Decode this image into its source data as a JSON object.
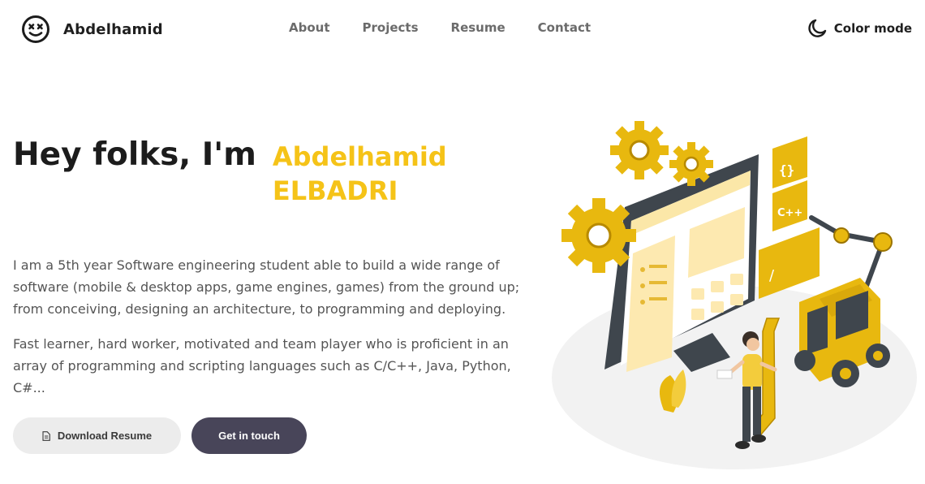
{
  "nav": {
    "brand_name": "Abdelhamid",
    "brand_icon": "smiley-face-icon",
    "links": [
      {
        "label": "About"
      },
      {
        "label": "Projects"
      },
      {
        "label": "Resume"
      },
      {
        "label": "Contact"
      }
    ],
    "color_mode_label": "Color mode",
    "color_mode_icon": "moon-icon"
  },
  "hero": {
    "greeting": "Hey folks, I'm",
    "name": "Abdelhamid ELBADRI",
    "bio_paragraphs": [
      "I am a 5th year Software engineering student able to build a wide range of software (mobile & desktop apps, game engines, games) from the ground up; from conceiving, designing an architecture, to programming and deploying.",
      "Fast learner, hard worker, motivated and team player who is proficient in an array of programming and scripting languages such as C/C++, Java, Python, C#..."
    ],
    "buttons": {
      "download_resume": "Download Resume",
      "get_in_touch": "Get in touch"
    },
    "illustration_labels": {
      "braces": "{}",
      "cpp": "C++",
      "slash": "/"
    }
  },
  "colors": {
    "accent": "#f5c318",
    "primary_button": "#484559",
    "secondary_button": "#ececec"
  }
}
